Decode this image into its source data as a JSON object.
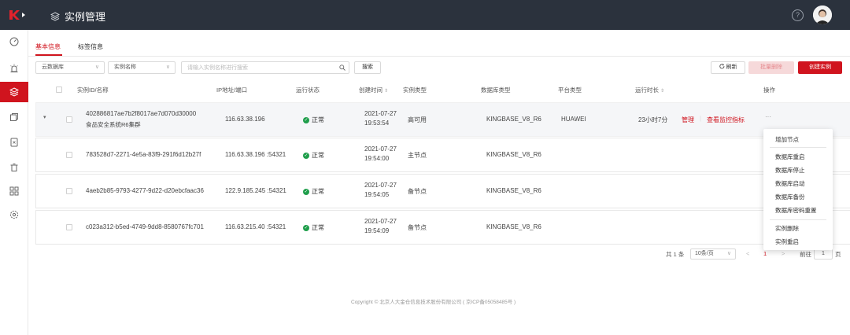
{
  "header": {
    "title": "实例管理",
    "help_glyph": "?"
  },
  "tabs": [
    {
      "label": "基本信息",
      "active": true
    },
    {
      "label": "标签信息",
      "active": false
    }
  ],
  "filters": {
    "db_select": "云数据库",
    "name_select": "实例名称",
    "search_placeholder": "请输入实例名称进行搜索",
    "search_button": "搜索"
  },
  "actions": {
    "refresh": "刷新",
    "batch_delete": "批量删除",
    "create": "创建实例"
  },
  "table": {
    "columns": [
      "实例ID/名称",
      "IP地址/端口",
      "运行状态",
      "创建时间",
      "实例类型",
      "数据库类型",
      "平台类型",
      "运行时长",
      "操作"
    ],
    "rows": [
      {
        "id": "402886817ae7b2f8017ae7d070d30000",
        "name": "食品安全系统R6集群",
        "ip": "116.63.38.196",
        "status": "正常",
        "date": "2021-07-27",
        "time": "19:53:54",
        "type": "高可用",
        "db_type": "KINGBASE_V8_R6",
        "platform": "HUAWEI",
        "runtime": "23小时7分",
        "op_manage": "管理",
        "op_monitor": "查看监控指标",
        "op_more": "···"
      },
      {
        "id": "783528d7-2271-4e5a-83f9-291f6d12b27f",
        "ip": "116.63.38.196 :54321",
        "status": "正常",
        "date": "2021-07-27",
        "time": "19:54:00",
        "type": "主节点",
        "db_type": "KINGBASE_V8_R6"
      },
      {
        "id": "4aeb2b85-9793-4277-9d22-d20ebcfaac36",
        "ip": "122.9.185.245 :54321",
        "status": "正常",
        "date": "2021-07-27",
        "time": "19:54:05",
        "type": "备节点",
        "db_type": "KINGBASE_V8_R6"
      },
      {
        "id": "c023a312-b5ed-4749-9dd8-8580767fc701",
        "ip": "116.63.215.40 :54321",
        "status": "正常",
        "date": "2021-07-27",
        "time": "19:54:09",
        "type": "备节点",
        "db_type": "KINGBASE_V8_R6"
      }
    ]
  },
  "dropdown_menu": {
    "items": [
      "增加节点",
      "数据库重启",
      "数据库停止",
      "数据库启动",
      "数据库备份",
      "数据库密码重置",
      "实例删除",
      "实例重启"
    ]
  },
  "pagination": {
    "total": "共 1 条",
    "page_size": "10条/页",
    "prev": "<",
    "current_page": "1",
    "next": ">",
    "goto_label": "前往",
    "goto_value": "1",
    "page_suffix": "页"
  },
  "footer": {
    "copyright": "Copyright © 北京人大金仓信息技术股份有限公司 ( 京ICP备05058485号 )"
  },
  "colors": {
    "accent": "#d0141e",
    "topbar": "#2b323d",
    "status_ok": "#1f9e4b"
  }
}
